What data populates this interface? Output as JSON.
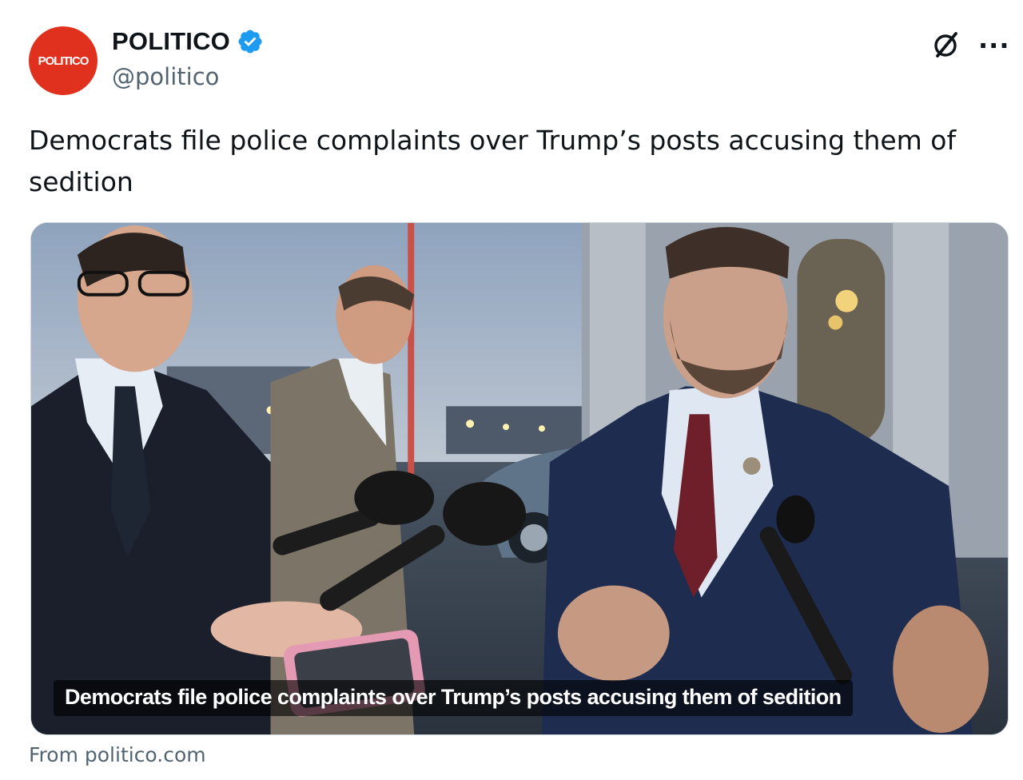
{
  "account": {
    "display_name": "POLITICO",
    "handle": "@politico",
    "avatar_text": "POLITICO",
    "verified_icon": "verified-badge-icon",
    "brand_color": "#e0311f",
    "verified_color": "#1d9bf0"
  },
  "actions": {
    "grok_icon": "grok-icon",
    "more_label": "···"
  },
  "post": {
    "text": "Democrats file police complaints over Trump’s posts accusing them of sedition"
  },
  "media": {
    "caption": "Democrats file police complaints over Trump’s posts accusing them of sedition",
    "source": "From politico.com"
  }
}
